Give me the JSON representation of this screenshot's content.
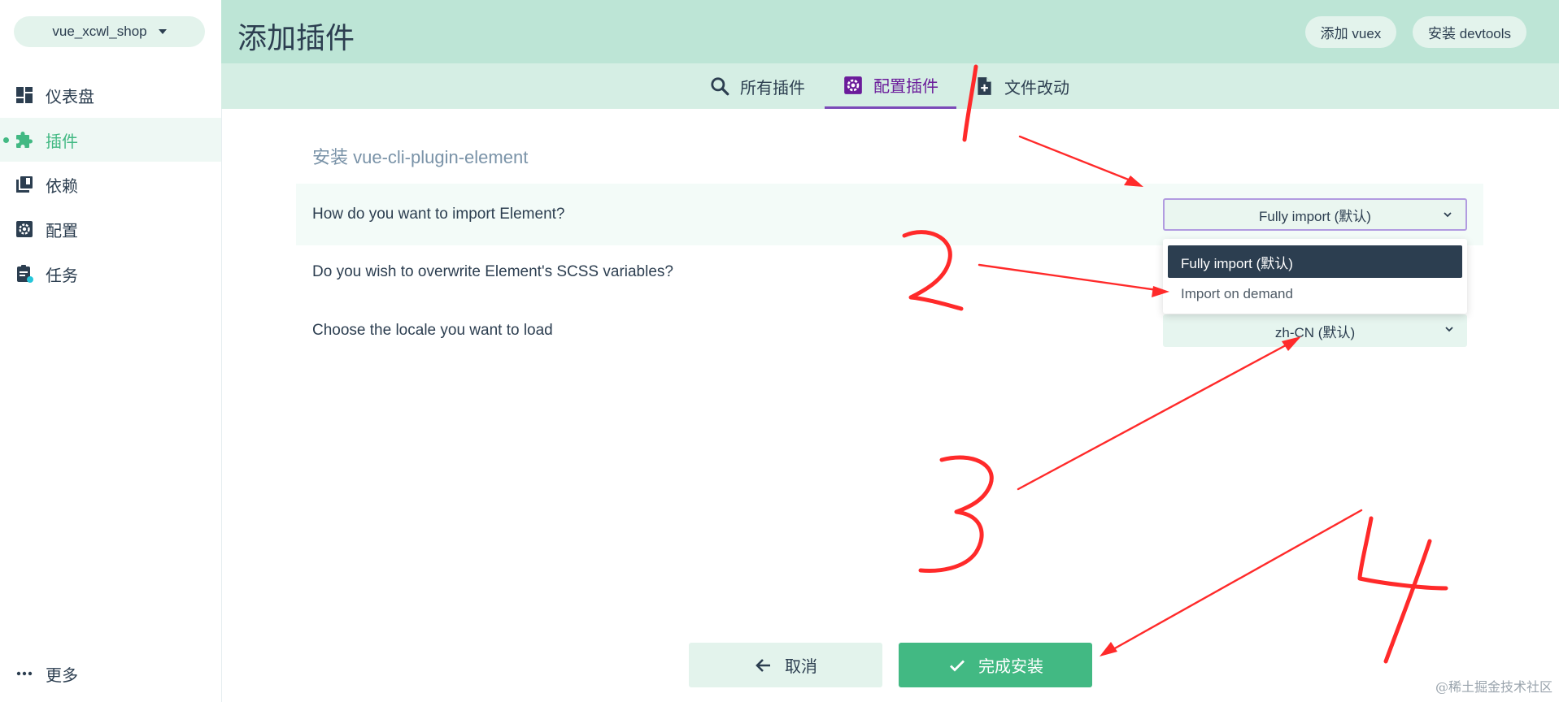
{
  "sidebar": {
    "project_name": "vue_xcwl_shop",
    "items": [
      {
        "label": "仪表盘",
        "icon": "dashboard-icon"
      },
      {
        "label": "插件",
        "icon": "puzzle-icon",
        "active": true
      },
      {
        "label": "依赖",
        "icon": "library-icon"
      },
      {
        "label": "配置",
        "icon": "gear-icon"
      },
      {
        "label": "任务",
        "icon": "clipboard-icon"
      }
    ],
    "more_label": "更多"
  },
  "header": {
    "title": "添加插件",
    "buttons": [
      "添加 vuex",
      "安装 devtools"
    ]
  },
  "tabs": [
    {
      "label": "所有插件",
      "icon": "search-icon"
    },
    {
      "label": "配置插件",
      "icon": "gear-icon",
      "active": true
    },
    {
      "label": "文件改动",
      "icon": "file-plus-icon"
    }
  ],
  "main": {
    "section_title": "安装 vue-cli-plugin-element",
    "prompts": [
      {
        "label": "How do you want to import Element?",
        "value": "Fully import (默认)"
      },
      {
        "label": "Do you wish to overwrite Element's SCSS variables?",
        "value": ""
      },
      {
        "label": "Choose the locale you want to load",
        "value": "zh-CN (默认)"
      }
    ],
    "dropdown_options": [
      "Fully import (默认)",
      "Import on demand"
    ],
    "cancel_label": "取消",
    "finish_label": "完成安装"
  },
  "watermark": "@稀土掘金技术社区",
  "colors": {
    "accent": "#42b983",
    "header_bg": "#bde5d6",
    "tab_active": "#6a1b9a",
    "annotation": "#ff2a2a"
  }
}
